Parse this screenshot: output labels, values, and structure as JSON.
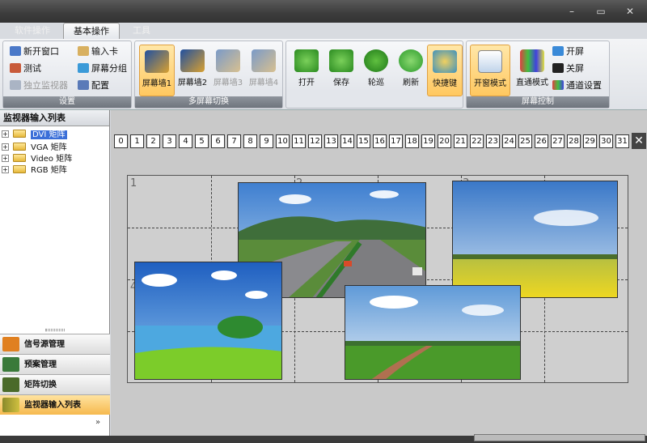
{
  "tabs": [
    "软件操作",
    "基本操作",
    "工具"
  ],
  "window_controls": {
    "minimize": "–",
    "restore": "▭",
    "close": "✕"
  },
  "ribbon": {
    "settings_group": {
      "caption": "设置",
      "items": [
        "新开窗口",
        "输入卡",
        "测试",
        "屏幕分组",
        "独立监视器",
        "配置"
      ]
    },
    "wall_group": {
      "caption": "多屏幕切换",
      "items": [
        "屏幕墙1",
        "屏幕墙2",
        "屏幕墙3",
        "屏幕墙4"
      ]
    },
    "file_group": {
      "items": [
        "打开",
        "保存",
        "轮巡",
        "刷新",
        "快捷键"
      ]
    },
    "screen_group": {
      "caption": "屏幕控制",
      "items": [
        "开窗模式",
        "直通模式",
        "开屏",
        "关屏",
        "通道设置"
      ]
    }
  },
  "left_panel": {
    "title": "监视器输入列表",
    "tree": [
      "DVI 矩阵",
      "VGA 矩阵",
      "Video 矩阵",
      "RGB 矩阵"
    ],
    "nav": [
      "信号源管理",
      "预案管理",
      "矩阵切换",
      "监视器输入列表"
    ],
    "more": "»"
  },
  "channels": [
    "0",
    "1",
    "2",
    "3",
    "4",
    "5",
    "6",
    "7",
    "8",
    "9",
    "10",
    "11",
    "12",
    "13",
    "14",
    "15",
    "16",
    "17",
    "18",
    "19",
    "20",
    "21",
    "22",
    "23",
    "24",
    "25",
    "26",
    "27",
    "28",
    "29",
    "30",
    "31"
  ],
  "close_label": "✕",
  "grid": {
    "cells": [
      "1",
      "2",
      "3",
      "4"
    ]
  },
  "colors": {
    "accent": "#ffc860",
    "selection": "#3b6fd8",
    "titlebar": "#3c3c3c"
  }
}
